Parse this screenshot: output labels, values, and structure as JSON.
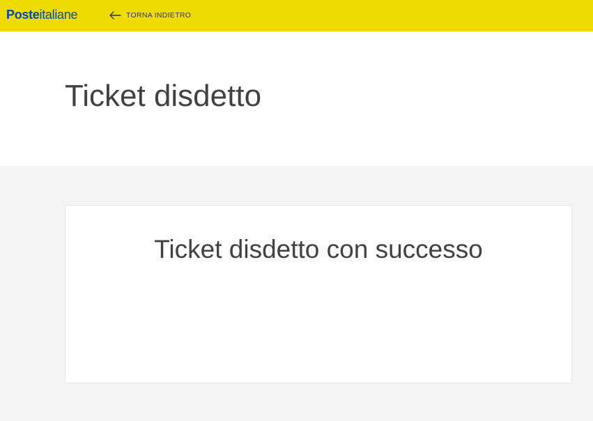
{
  "header": {
    "logo": {
      "bold_part": "Poste",
      "light_part": "italiane"
    },
    "back_link": {
      "icon": "arrow-left-icon",
      "label": "TORNA INDIETRO"
    }
  },
  "page": {
    "title": "Ticket disdetto"
  },
  "card": {
    "message": "Ticket disdetto con successo"
  },
  "colors": {
    "topbar": "#eedc00",
    "logo": "#0047bb",
    "text": "#414141",
    "page_background": "#f4f4f4"
  }
}
